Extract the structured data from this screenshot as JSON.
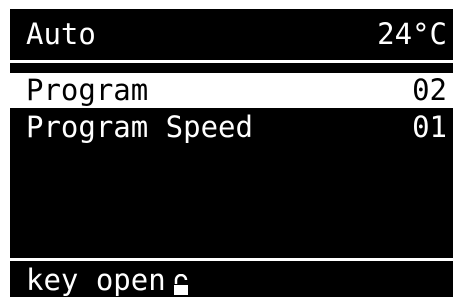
{
  "header": {
    "mode": "Auto",
    "temperature": "24°C"
  },
  "menu": {
    "items": [
      {
        "label": "Program",
        "value": "02",
        "selected": true
      },
      {
        "label": "Program Speed",
        "value": "01",
        "selected": false
      }
    ]
  },
  "footer": {
    "status": "key open",
    "icon": "unlocked-padlock-icon"
  }
}
